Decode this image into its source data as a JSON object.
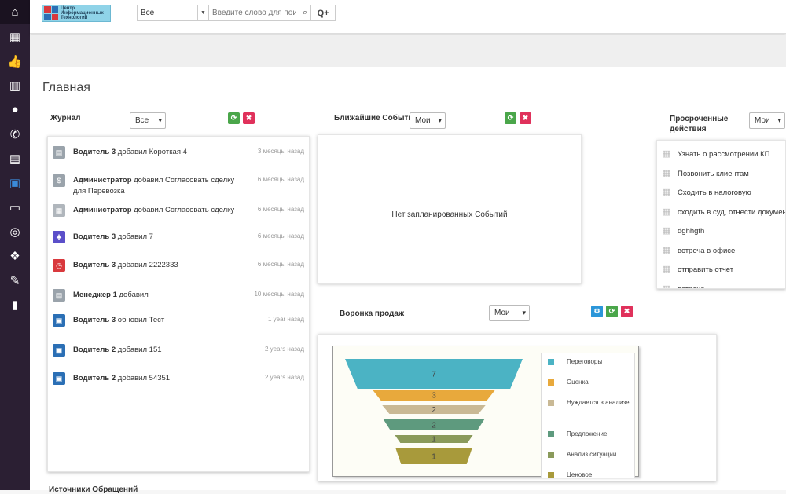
{
  "sidebar": {
    "items": [
      {
        "icon": "home-icon",
        "glyph": "⌂"
      },
      {
        "icon": "calendar-clock-icon",
        "glyph": "▦"
      },
      {
        "icon": "thumbs-up-icon",
        "glyph": "👍"
      },
      {
        "icon": "building-icon",
        "glyph": "▥"
      },
      {
        "icon": "user-icon",
        "glyph": "●"
      },
      {
        "icon": "phone-icon",
        "glyph": "✆"
      },
      {
        "icon": "clipboard-icon",
        "glyph": "▤"
      },
      {
        "icon": "iso-icon",
        "glyph": "▣"
      },
      {
        "icon": "money-icon",
        "glyph": "▭"
      },
      {
        "icon": "lifebuoy-icon",
        "glyph": "◎"
      },
      {
        "icon": "cubes-icon",
        "glyph": "❖"
      },
      {
        "icon": "wrench-icon",
        "glyph": "✎"
      },
      {
        "icon": "bar-chart-icon",
        "glyph": "▮"
      }
    ]
  },
  "header": {
    "logo_line1": "Центр",
    "logo_line2": "Информационных",
    "logo_line3": "Технологий",
    "search_scope": "Все",
    "search_placeholder": "Введите слово для поиска",
    "search_button": "🔍",
    "advanced_search_button": "Q+"
  },
  "page_title": "Главная",
  "journal": {
    "title": "Журнал",
    "filter": "Все",
    "refresh": "⟳",
    "close": "✖",
    "rows": [
      {
        "actor": "Водитель 3",
        "action": "добавил Короткая 4",
        "time": "3 месяцы назад",
        "icon": "document-icon",
        "color": "#9aa3ab",
        "glyph": "▤"
      },
      {
        "actor": "Администратор",
        "action": "добавил Согласовать сделку для Перевозка",
        "time": "6 месяцы назад",
        "icon": "dollar-icon",
        "color": "#9aa3ab",
        "glyph": "$"
      },
      {
        "actor": "Администратор",
        "action": "добавил Согласовать сделку",
        "time": "6 месяцы назад",
        "icon": "calendar-icon",
        "color": "#b0b6bc",
        "glyph": "▦"
      },
      {
        "actor": "Водитель 3",
        "action": "добавил 7",
        "time": "6 месяцы назад",
        "icon": "puzzle-icon",
        "color": "#5b4fc9",
        "glyph": "✱"
      },
      {
        "actor": "Водитель 3",
        "action": "добавил 2222333",
        "time": "6 месяцы назад",
        "icon": "clock-icon",
        "color": "#d9393d",
        "glyph": "◷"
      },
      {
        "actor": "Менеджер 1",
        "action": "добавил",
        "time": "10 месяцы назад",
        "icon": "form-icon",
        "color": "#9aa3ab",
        "glyph": "▤"
      },
      {
        "actor": "Водитель 3",
        "action": "обновил Тест",
        "time": "1 year назад",
        "icon": "iso-icon",
        "color": "#2b6fb5",
        "glyph": "▣"
      },
      {
        "actor": "Водитель 2",
        "action": "добавил 151",
        "time": "2 years назад",
        "icon": "iso-icon",
        "color": "#2b6fb5",
        "glyph": "▣"
      },
      {
        "actor": "Водитель 2",
        "action": "добавил 54351",
        "time": "2 years назад",
        "icon": "iso-icon",
        "color": "#2b6fb5",
        "glyph": "▣"
      }
    ]
  },
  "events": {
    "title": "Ближайшие События",
    "filter": "Мои",
    "refresh": "⟳",
    "close": "✖",
    "empty_text": "Нет запланированных Событий"
  },
  "overdue": {
    "title_line1": "Просроченные",
    "title_line2": "действия",
    "filter": "Мои",
    "items": [
      "Узнать о рассмотрении КП",
      "Позвонить клиентам",
      "Сходить в налоговую",
      "сходить в суд, отнести документы",
      "dghhgfh",
      "встреча в офисе",
      "отправить отчет",
      "встреча"
    ]
  },
  "funnel": {
    "title": "Воронка продаж",
    "filter": "Мои",
    "settings": "⚙",
    "refresh": "⟳",
    "close": "✖"
  },
  "chart_data": {
    "type": "funnel",
    "categories": [
      "Переговоры",
      "Оценка",
      "Нуждается в анализе",
      "Предложение",
      "Анализ ситуации",
      "Ценовое"
    ],
    "values": [
      7,
      3,
      2,
      2,
      1,
      1
    ],
    "colors": [
      "#4bb3c4",
      "#e8a93c",
      "#c9b995",
      "#5e9a7e",
      "#8a9a5b",
      "#a89a3b"
    ]
  },
  "bottom_widget": {
    "title": "Источники Обращений"
  }
}
